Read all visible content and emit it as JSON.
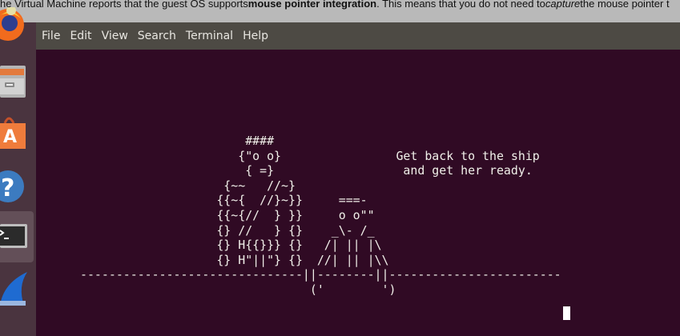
{
  "vbox_notice": {
    "prefix": "he Virtual Machine reports that the guest OS supports ",
    "bold": "mouse pointer integration",
    "middle": ". This means that you do not need to ",
    "italic": "capture",
    "suffix": " the mouse pointer t"
  },
  "dock": {
    "items": [
      {
        "name": "firefox",
        "icon": "firefox-icon"
      },
      {
        "name": "files",
        "icon": "file-cabinet-icon"
      },
      {
        "name": "software",
        "icon": "shopping-bag-icon"
      },
      {
        "name": "help",
        "icon": "help-icon"
      },
      {
        "name": "terminal",
        "icon": "terminal-icon",
        "active": true
      },
      {
        "name": "wireshark",
        "icon": "shark-fin-icon"
      }
    ]
  },
  "menubar": {
    "items": [
      "File",
      "Edit",
      "View",
      "Search",
      "Terminal",
      "Help"
    ]
  },
  "terminal": {
    "background": "#300a24",
    "lines": [
      "                       ####",
      "                      {\"o o}                Get back to the ship",
      "                       { =}                  and get her ready.",
      "                    {~~   //~}",
      "                   {{~{  //}~}}     ===-",
      "                   {{~{//  } }}     o o\"\"",
      "                   {} //   } {}    _\\- /_",
      "                   {} H{{}}} {}   /| || |\\",
      "                   {} H\"||\"} {}  //| || |\\\\",
      "-------------------------------||--------||------------------------",
      "                                ('        ')"
    ]
  }
}
